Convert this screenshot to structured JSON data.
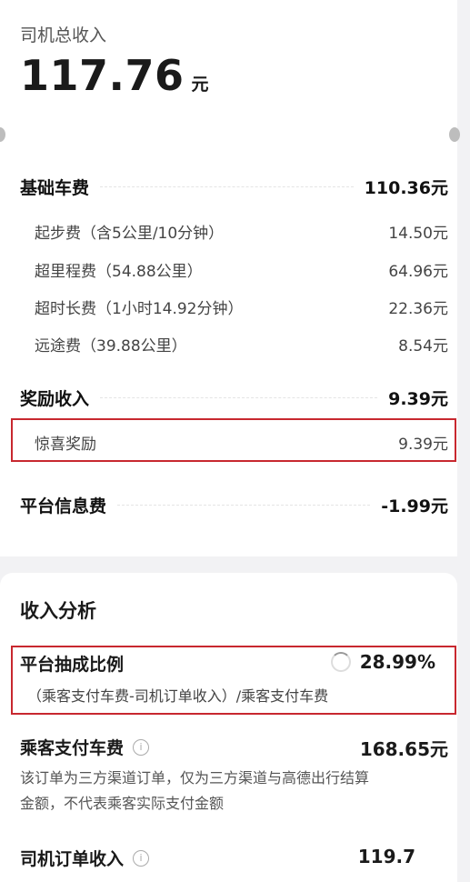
{
  "header": {
    "title": "司机总收入",
    "total_amount": "117.76",
    "total_unit": "元"
  },
  "base_fare": {
    "label": "基础车费",
    "value": "110.36元",
    "items": [
      {
        "label": "起步费（含5公里/10分钟）",
        "value": "14.50元"
      },
      {
        "label": "超里程费（54.88公里）",
        "value": "64.96元"
      },
      {
        "label": "超时长费（1小时14.92分钟）",
        "value": "22.36元"
      },
      {
        "label": "远途费（39.88公里）",
        "value": "8.54元"
      }
    ]
  },
  "reward": {
    "label": "奖励收入",
    "value": "9.39元",
    "items": [
      {
        "label": "惊喜奖励",
        "value": "9.39元"
      }
    ]
  },
  "platform_fee": {
    "label": "平台信息费",
    "value": "-1.99元"
  },
  "analysis": {
    "title": "收入分析",
    "commission": {
      "label": "平台抽成比例",
      "value": "28.99%",
      "formula": "（乘客支付车费-司机订单收入）/乘客支付车费"
    },
    "passenger_fare": {
      "label": "乘客支付车费",
      "value": "168.65元",
      "desc_line1": "该订单为三方渠道订单，仅为三方渠道与高德出行结算",
      "desc_line2": "金额，不代表乘客实际支付金额"
    },
    "driver_income": {
      "label": "司机订单收入",
      "value": "119.7"
    }
  },
  "colors": {
    "highlight_box": "#c8282f"
  },
  "icons": {
    "info": "info-circle-icon",
    "loading": "spinner-icon"
  }
}
